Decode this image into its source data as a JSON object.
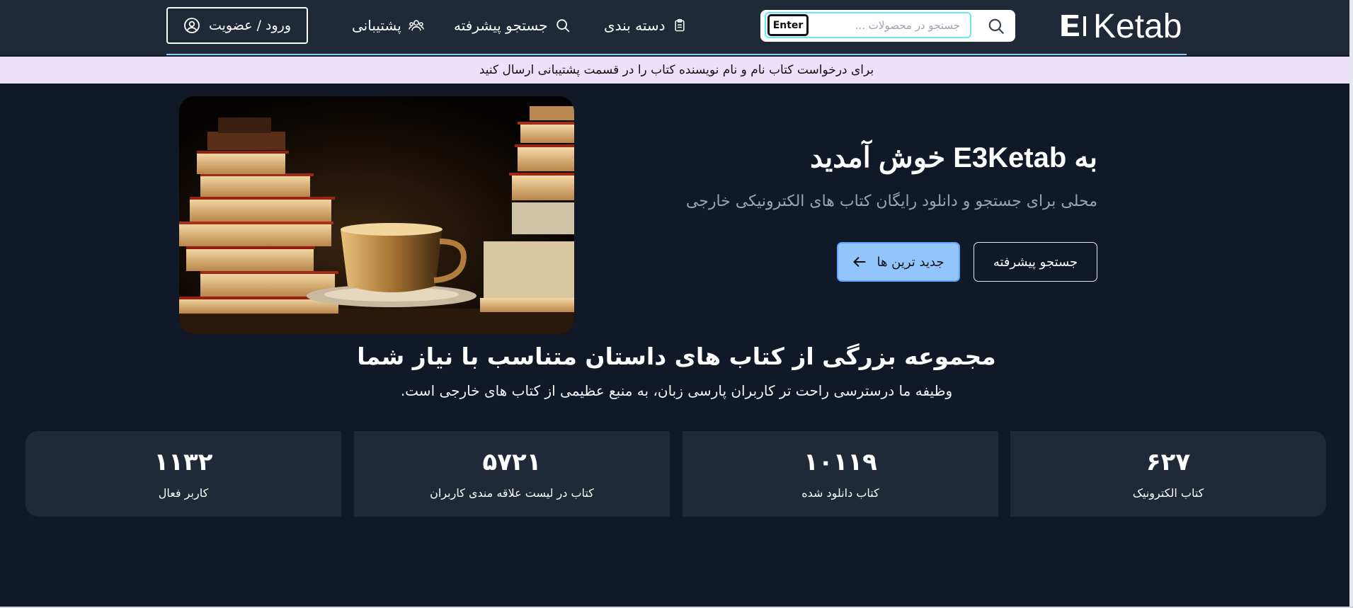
{
  "header": {
    "logo_text": "E3Ketab",
    "search": {
      "placeholder": "جستجو در محصولات ...",
      "enter_label": "Enter"
    },
    "nav": {
      "categories": "دسته بندی",
      "advanced_search": "جستجو پیشرفته",
      "support": "پشتیبانی"
    },
    "login_label": "ورود / عضویت"
  },
  "notice": "برای درخواست کتاب نام و نام نویسنده کتاب را در قسمت پشتیبانی ارسال کنید",
  "hero": {
    "title": "به E3Ketab خوش آمدید",
    "subtitle": "محلی برای جستجو و دانلود رایگان کتاب های الکترونیکی خارجی",
    "advanced_button": "جستجو پیشرفته",
    "newest_button": "جدید ترین ها"
  },
  "section": {
    "title": "مجموعه بزرگی از کتاب های داستان متناسب با نیاز شما",
    "subtitle": "وظیفه ما درسترسی راحت تر کاربران پارسی زبان، به منبع عظیمی از کتاب های خارجی است."
  },
  "stats": [
    {
      "value": "۶۲۷",
      "label": "کتاب الکترونیک"
    },
    {
      "value": "۱۰۱۱۹",
      "label": "کتاب دانلود شده"
    },
    {
      "value": "۵۷۲۱",
      "label": "کتاب در لیست علاقه مندی کاربران"
    },
    {
      "value": "۱۱۳۲",
      "label": "کاربر فعال"
    }
  ],
  "colors": {
    "page_bg": "#111827",
    "header_bg": "#1f2937",
    "notice_bg": "#ede0fb",
    "accent_button": "#93c5fd",
    "input_border": "#67e8f9"
  },
  "icons": [
    "search-icon",
    "clipboard-icon",
    "users-icon",
    "user-circle-icon",
    "arrow-left-icon"
  ]
}
